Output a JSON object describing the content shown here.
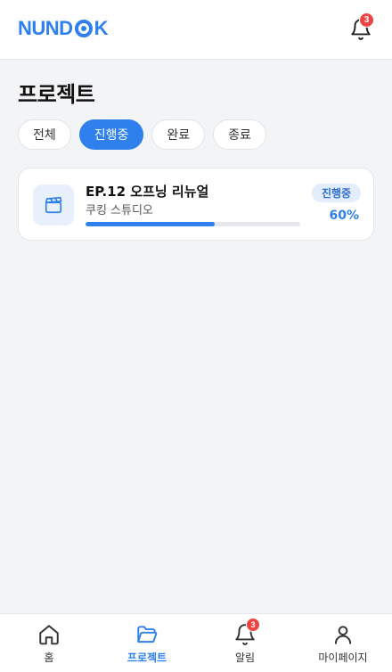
{
  "header": {
    "logo_left": "NUND",
    "logo_right": "K",
    "notification_count": "3"
  },
  "page": {
    "title": "프로젝트"
  },
  "filters": [
    {
      "label": "전체",
      "active": false
    },
    {
      "label": "진행중",
      "active": true
    },
    {
      "label": "완료",
      "active": false
    },
    {
      "label": "종료",
      "active": false
    }
  ],
  "projects": [
    {
      "title": "EP.12 오프닝 리뉴얼",
      "client": "쿠킹 스튜디오",
      "status": "진행중",
      "progress_percent": "60%",
      "progress_value": 60,
      "icon": "clapperboard-icon"
    }
  ],
  "tabbar": {
    "items": [
      {
        "label": "홈",
        "icon": "home-icon",
        "active": false
      },
      {
        "label": "프로젝트",
        "icon": "folder-icon",
        "active": true
      },
      {
        "label": "알림",
        "icon": "bell-icon",
        "active": false,
        "badge": "3"
      },
      {
        "label": "마이페이지",
        "icon": "user-icon",
        "active": false
      }
    ]
  },
  "colors": {
    "accent": "#2f80ed",
    "badge": "#ef4444"
  }
}
